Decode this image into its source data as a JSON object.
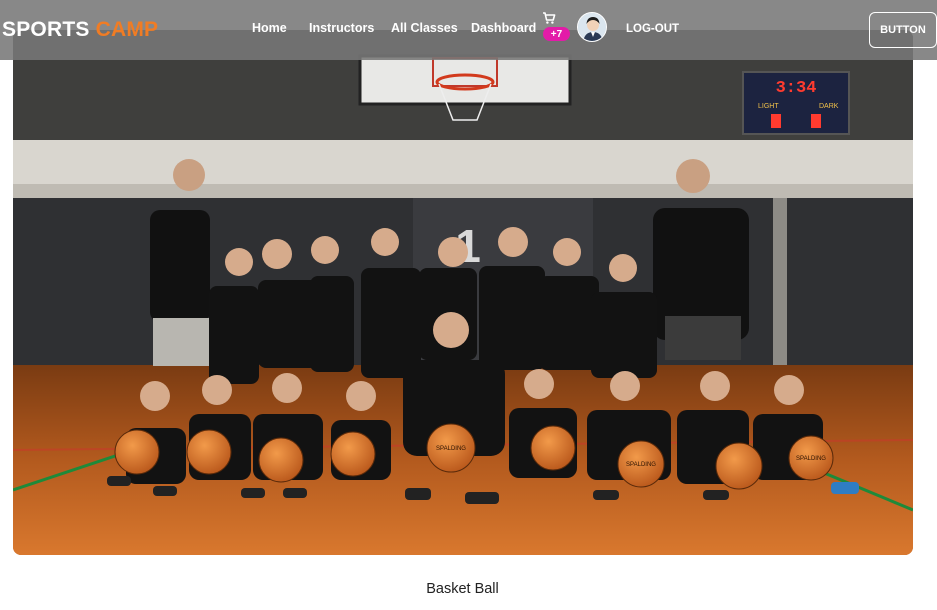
{
  "brand": {
    "part1": "SPORTS ",
    "part2": "CAMP"
  },
  "nav": {
    "home": "Home",
    "instructors": "Instructors",
    "all_classes": "All Classes",
    "dashboard": "Dashboard",
    "logout": "LOG-OUT"
  },
  "cart": {
    "icon": "cart-icon",
    "count": "+7"
  },
  "avatar": {
    "icon": "user-avatar"
  },
  "action_button": "BUTTON",
  "card": {
    "caption": "Basket Ball",
    "scoreboard": {
      "time": "3:34",
      "left": "LIGHT",
      "right": "DARK"
    },
    "jersey_number": "1",
    "ball_brand": "SPALDING"
  },
  "colors": {
    "brand_orange": "#f07c24",
    "badge_pink": "#e31ba8",
    "navbar": "#787878"
  }
}
